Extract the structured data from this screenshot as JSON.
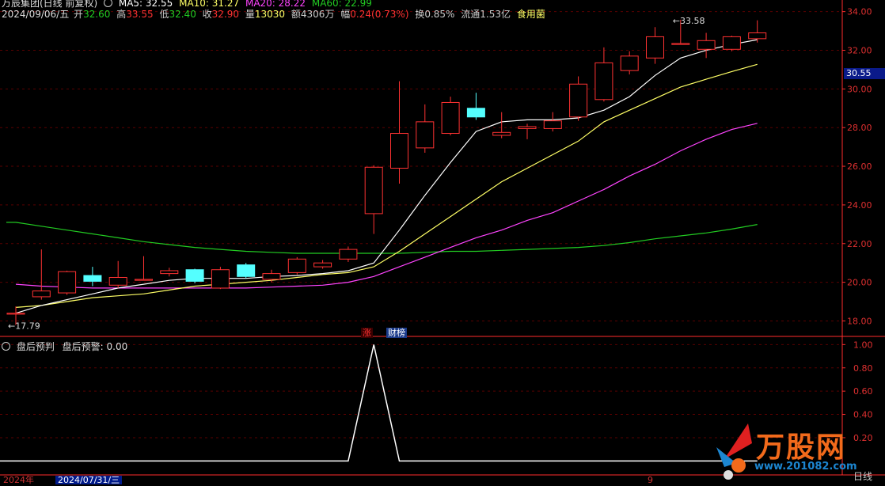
{
  "header": {
    "stock_name": "万辰集团(日线 前复权)",
    "date": "2024/09/06/五",
    "open_label": "开",
    "open_value": "32.60",
    "high_label": "高",
    "high_value": "33.55",
    "low_label": "低",
    "low_value": "32.40",
    "close_label": "收",
    "close_value": "32.90",
    "volume_label": "量",
    "volume_value": "13030",
    "amount_label": "额",
    "amount_value": "4306万",
    "change_label": "幅",
    "change_value": "0.24(0.73%)",
    "turnover": "换0.85%",
    "float_cap": "流通1.53亿",
    "sector": "食用菌",
    "ma5": "MA5: 32.55",
    "ma10": "MA10: 31.27",
    "ma20": "MA20: 28.22",
    "ma60": "MA60: 22.99"
  },
  "sub_header": {
    "indicator": "盘后预判",
    "series_label": "盘后预警: 0.00"
  },
  "tags": {
    "zhang": "涨",
    "caibang": "财榜"
  },
  "price_badge": "30.55",
  "bottom": {
    "year": "2024年",
    "cursor_date": "2024/07/31/三",
    "mark": "9",
    "period": "日线"
  },
  "logo": {
    "text": "万股网",
    "url": "www.201082.com"
  },
  "colors": {
    "up": "#ff3232",
    "down": "#54ffff",
    "ma5": "#ffffff",
    "ma10": "#ffff66",
    "ma20": "#ff44ff",
    "ma60": "#22cc22",
    "axis": "#ff2d2d",
    "signal": "#ffffff"
  },
  "chart_data": [
    {
      "type": "candlestick",
      "y_ticks": [
        18.0,
        20.0,
        22.0,
        24.0,
        26.0,
        28.0,
        30.0,
        32.0,
        34.0
      ],
      "ylim": [
        17.2,
        34.6
      ],
      "annotations": [
        {
          "label": "17.79",
          "x_index": 0,
          "y": 17.79
        },
        {
          "label": "33.58",
          "x_index": 26,
          "y": 33.58
        }
      ],
      "candles": [
        {
          "o": 18.35,
          "c": 18.4,
          "h": 18.75,
          "l": 17.79
        },
        {
          "o": 19.25,
          "c": 19.55,
          "h": 21.7,
          "l": 19.1
        },
        {
          "o": 19.45,
          "c": 20.55,
          "h": 20.6,
          "l": 19.35
        },
        {
          "o": 20.35,
          "c": 20.05,
          "h": 20.8,
          "l": 19.8
        },
        {
          "o": 19.85,
          "c": 20.25,
          "h": 21.1,
          "l": 19.7
        },
        {
          "o": 20.15,
          "c": 20.15,
          "h": 21.35,
          "l": 20.1
        },
        {
          "o": 20.45,
          "c": 20.6,
          "h": 20.75,
          "l": 20.3
        },
        {
          "o": 20.65,
          "c": 20.05,
          "h": 20.7,
          "l": 19.95
        },
        {
          "o": 19.7,
          "c": 20.65,
          "h": 20.8,
          "l": 19.65
        },
        {
          "o": 20.9,
          "c": 20.3,
          "h": 21.0,
          "l": 20.2
        },
        {
          "o": 20.15,
          "c": 20.45,
          "h": 20.65,
          "l": 20.0
        },
        {
          "o": 20.5,
          "c": 21.2,
          "h": 21.3,
          "l": 20.4
        },
        {
          "o": 20.8,
          "c": 21.0,
          "h": 21.15,
          "l": 20.7
        },
        {
          "o": 21.2,
          "c": 21.7,
          "h": 21.85,
          "l": 21.05
        },
        {
          "o": 23.55,
          "c": 25.95,
          "h": 26.05,
          "l": 22.5
        },
        {
          "o": 25.9,
          "c": 27.7,
          "h": 30.4,
          "l": 25.1
        },
        {
          "o": 26.95,
          "c": 28.3,
          "h": 29.2,
          "l": 26.7
        },
        {
          "o": 27.7,
          "c": 29.3,
          "h": 29.6,
          "l": 27.6
        },
        {
          "o": 29.0,
          "c": 28.55,
          "h": 29.8,
          "l": 28.4
        },
        {
          "o": 27.6,
          "c": 27.75,
          "h": 28.8,
          "l": 27.45
        },
        {
          "o": 27.95,
          "c": 28.05,
          "h": 28.2,
          "l": 27.4
        },
        {
          "o": 27.95,
          "c": 28.35,
          "h": 28.8,
          "l": 27.8
        },
        {
          "o": 28.55,
          "c": 30.25,
          "h": 30.65,
          "l": 28.35
        },
        {
          "o": 29.45,
          "c": 31.35,
          "h": 32.15,
          "l": 29.35
        },
        {
          "o": 30.95,
          "c": 31.7,
          "h": 31.95,
          "l": 30.75
        },
        {
          "o": 31.6,
          "c": 32.7,
          "h": 33.2,
          "l": 31.3
        },
        {
          "o": 32.35,
          "c": 32.35,
          "h": 33.58,
          "l": 32.3
        },
        {
          "o": 32.05,
          "c": 32.5,
          "h": 32.9,
          "l": 31.6
        },
        {
          "o": 32.05,
          "c": 32.7,
          "h": 32.75,
          "l": 31.95
        },
        {
          "o": 32.6,
          "c": 32.9,
          "h": 33.55,
          "l": 32.4
        }
      ],
      "ma": {
        "ma5": [
          18.4,
          18.8,
          19.1,
          19.4,
          19.7,
          19.9,
          20.1,
          20.2,
          20.2,
          20.2,
          20.3,
          20.35,
          20.45,
          20.6,
          21.0,
          22.7,
          24.5,
          26.2,
          27.8,
          28.3,
          28.4,
          28.4,
          28.5,
          28.9,
          29.6,
          30.7,
          31.6,
          32.0,
          32.3,
          32.55
        ],
        "ma10": [
          18.7,
          18.8,
          19.0,
          19.2,
          19.3,
          19.4,
          19.6,
          19.8,
          19.9,
          20.0,
          20.1,
          20.25,
          20.4,
          20.5,
          20.8,
          21.6,
          22.5,
          23.4,
          24.3,
          25.2,
          25.9,
          26.6,
          27.3,
          28.3,
          28.9,
          29.5,
          30.1,
          30.5,
          30.9,
          31.27
        ],
        "ma20": [
          19.9,
          19.8,
          19.75,
          19.7,
          19.7,
          19.7,
          19.7,
          19.7,
          19.7,
          19.7,
          19.75,
          19.8,
          19.85,
          20.0,
          20.3,
          20.8,
          21.3,
          21.8,
          22.3,
          22.7,
          23.2,
          23.6,
          24.2,
          24.8,
          25.5,
          26.1,
          26.8,
          27.4,
          27.9,
          28.22
        ],
        "ma60": [
          23.1,
          22.9,
          22.7,
          22.5,
          22.3,
          22.1,
          21.95,
          21.8,
          21.7,
          21.6,
          21.55,
          21.5,
          21.5,
          21.5,
          21.5,
          21.5,
          21.55,
          21.6,
          21.6,
          21.65,
          21.7,
          21.75,
          21.8,
          21.9,
          22.05,
          22.25,
          22.4,
          22.55,
          22.75,
          22.99
        ]
      }
    },
    {
      "type": "line",
      "name": "盘后预警",
      "y_ticks": [
        0.2,
        0.4,
        0.6,
        0.8,
        1.0
      ],
      "ylim": [
        -0.12,
        1.05
      ],
      "values": [
        0,
        0,
        0,
        0,
        0,
        0,
        0,
        0,
        0,
        0,
        0,
        0,
        0,
        0,
        1,
        0,
        0,
        0,
        0,
        0,
        0,
        0,
        0,
        0,
        0,
        0,
        0,
        0,
        0,
        0
      ]
    }
  ]
}
